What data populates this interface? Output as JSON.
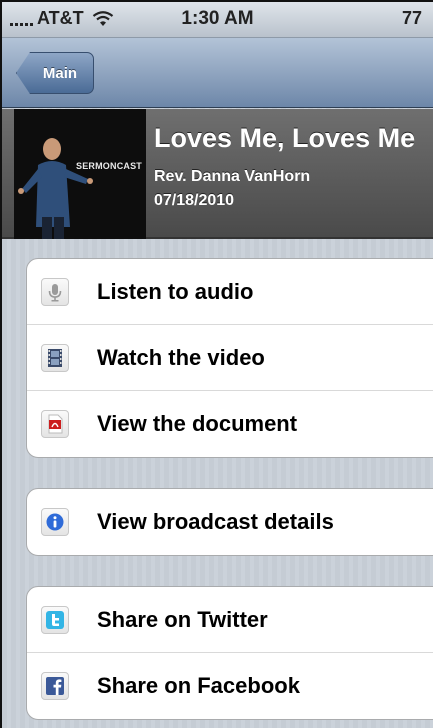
{
  "status_bar": {
    "carrier": "AT&T",
    "time": "1:30 AM",
    "battery": "77"
  },
  "nav_bar": {
    "back_label": "Main"
  },
  "header": {
    "thumbnail_text": "SERMONCAST",
    "title": "Loves Me, Loves Me",
    "speaker": "Rev. Danna VanHorn",
    "date": "07/18/2010"
  },
  "media_group": [
    {
      "label": "Listen to audio",
      "icon": "microphone-icon"
    },
    {
      "label": "Watch the video",
      "icon": "film-icon"
    },
    {
      "label": "View the document",
      "icon": "pdf-icon"
    }
  ],
  "info_group": [
    {
      "label": "View broadcast details",
      "icon": "info-icon"
    }
  ],
  "share_group": [
    {
      "label": "Share on Twitter",
      "icon": "twitter-icon"
    },
    {
      "label": "Share on Facebook",
      "icon": "facebook-icon"
    }
  ],
  "colors": {
    "nav_top": "#b3c3d7",
    "nav_bottom": "#6d87a9",
    "header_bg": "#5a5a5a",
    "table_bg": "#c5ccd4",
    "facebook": "#3b5998",
    "twitter": "#33b5e5",
    "info": "#2f6bd8",
    "pdf": "#cc1f1f"
  }
}
